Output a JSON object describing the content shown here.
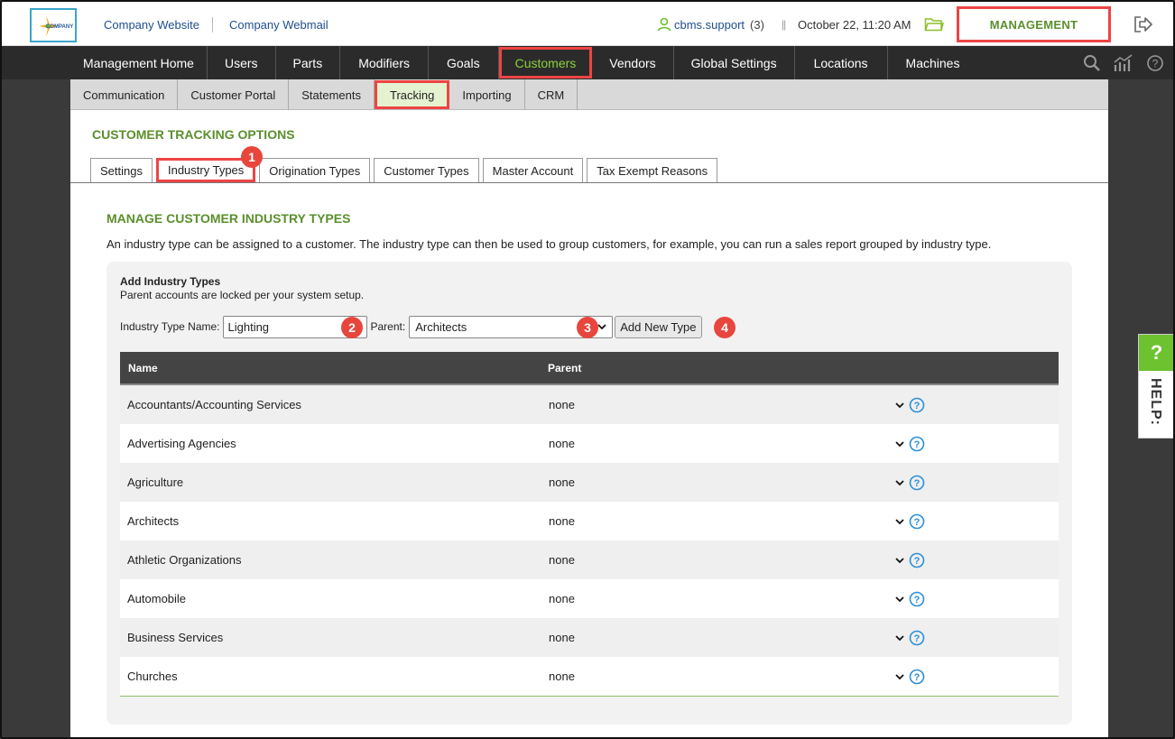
{
  "topbar": {
    "logo_text": "COMPANY",
    "links": [
      "Company Website",
      "Company Webmail"
    ],
    "user_name": "cbms.support",
    "user_count": "(3)",
    "divider": "||",
    "datetime": "October 22, 11:20 AM",
    "management_label": "MANAGEMENT"
  },
  "mainnav": {
    "items": [
      "Management Home",
      "Users",
      "Parts",
      "Modifiers",
      "Goals",
      "Customers",
      "Vendors",
      "Global Settings",
      "Locations",
      "Machines"
    ],
    "active": "Customers"
  },
  "subnav": {
    "items": [
      "Communication",
      "Customer Portal",
      "Statements",
      "Tracking",
      "Importing",
      "CRM"
    ],
    "active": "Tracking"
  },
  "page": {
    "section_title": "CUSTOMER TRACKING OPTIONS",
    "tabs": [
      "Settings",
      "Industry Types",
      "Origination Types",
      "Customer Types",
      "Master Account",
      "Tax Exempt Reasons"
    ],
    "active_tab": "Industry Types",
    "sub_title": "MANAGE CUSTOMER INDUSTRY TYPES",
    "description": "An industry type can be assigned to a customer. The industry type can then be used to group customers, for example, you can run a sales report grouped by industry type."
  },
  "form": {
    "heading": "Add Industry Types",
    "note": "Parent accounts are locked per your system setup.",
    "name_label": "Industry Type Name:",
    "name_value": "Lighting",
    "parent_label": "Parent:",
    "parent_value": "Architects",
    "add_button": "Add New Type"
  },
  "badges": [
    "1",
    "2",
    "3",
    "4"
  ],
  "table": {
    "headers": [
      "Name",
      "Parent"
    ],
    "rows": [
      {
        "name": "Accountants/Accounting Services",
        "parent": "none"
      },
      {
        "name": "Advertising Agencies",
        "parent": "none"
      },
      {
        "name": "Agriculture",
        "parent": "none"
      },
      {
        "name": "Architects",
        "parent": "none"
      },
      {
        "name": "Athletic Organizations",
        "parent": "none"
      },
      {
        "name": "Automobile",
        "parent": "none"
      },
      {
        "name": "Business Services",
        "parent": "none"
      },
      {
        "name": "Churches",
        "parent": "none"
      }
    ]
  },
  "help": {
    "icon": "?",
    "label": "HELP:"
  },
  "colors": {
    "accent_green": "#5b8f2d",
    "highlight_red": "#e44444",
    "nav_bg": "#2b2b2b",
    "help_green": "#6cc22f"
  }
}
